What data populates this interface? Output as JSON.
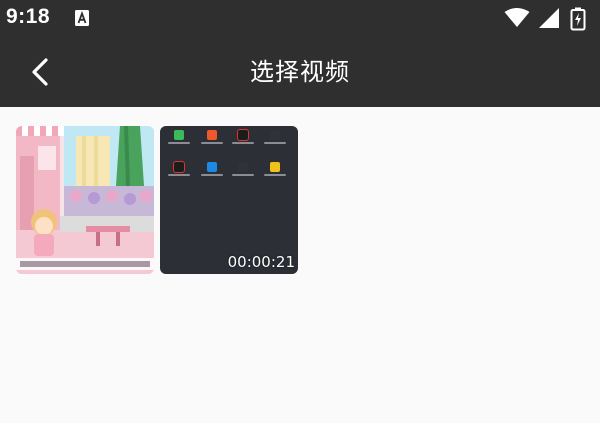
{
  "status_bar": {
    "time": "9:18",
    "icons": [
      "notification-a-icon",
      "wifi-icon",
      "cell-signal-icon",
      "battery-icon"
    ]
  },
  "app_bar": {
    "title": "选择视频",
    "back_icon": "chevron-left-icon"
  },
  "videos": [
    {
      "thumbnail": "cartoon-room-scene",
      "duration": ""
    },
    {
      "thumbnail": "phone-home-screen",
      "duration": "00:00:21"
    }
  ],
  "colors": {
    "bar_background": "#2f2f2f",
    "page_background": "#fafafa",
    "text_on_bar": "#ffffff"
  }
}
